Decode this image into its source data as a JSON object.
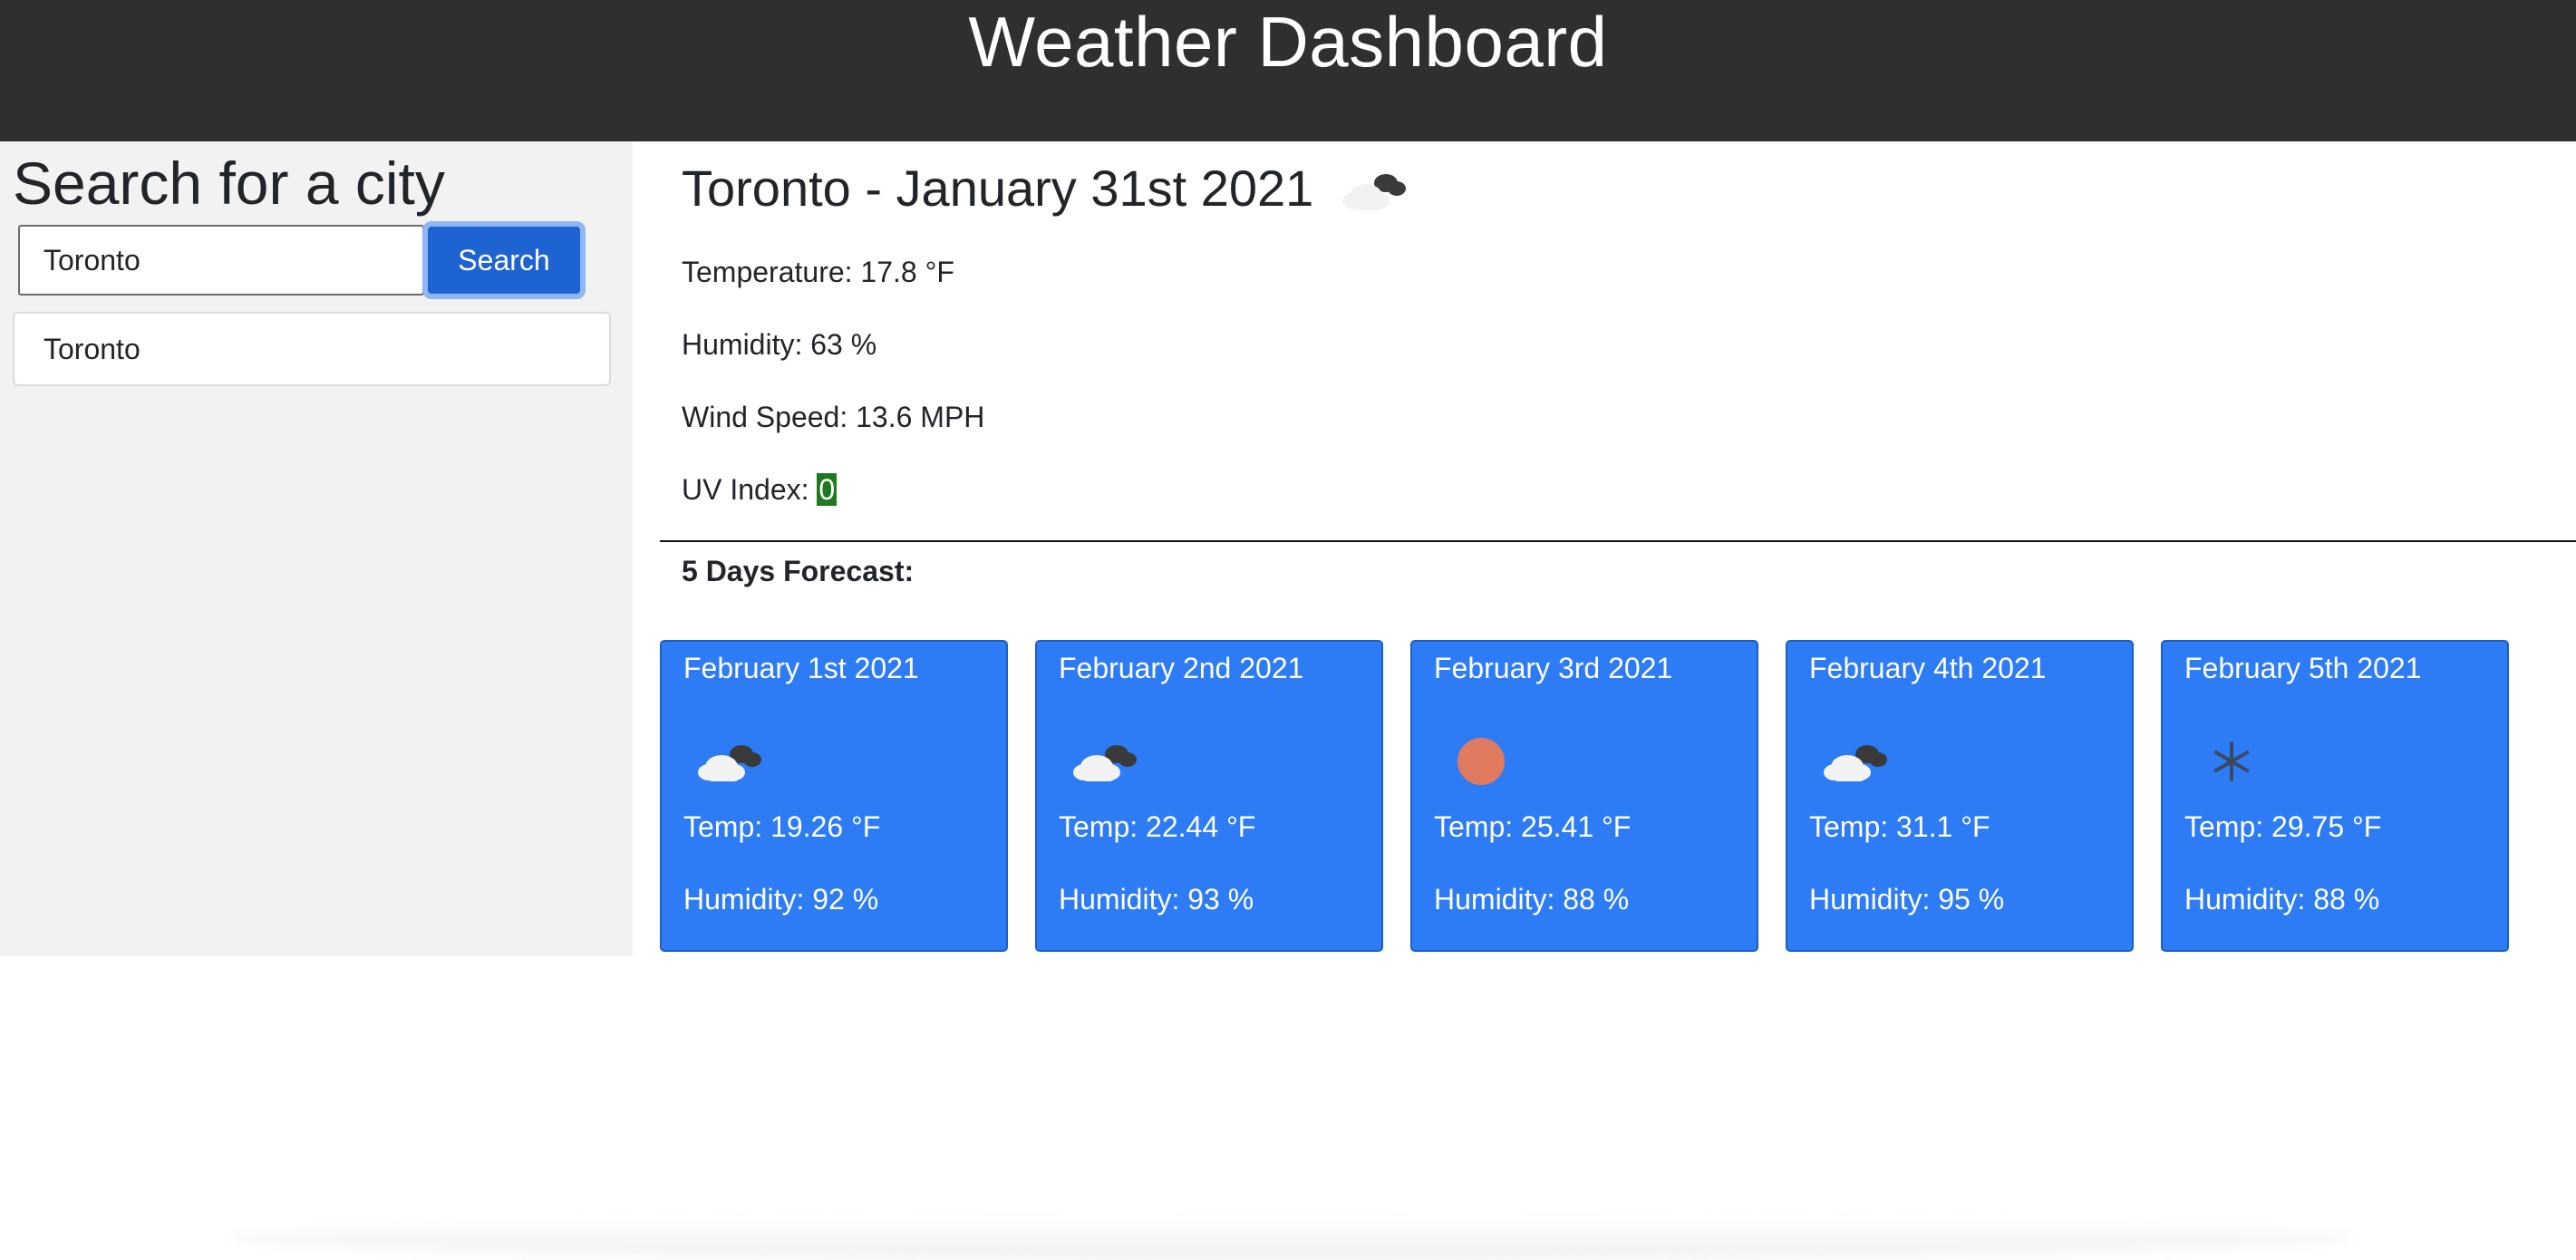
{
  "header": {
    "title": "Weather Dashboard"
  },
  "sidebar": {
    "heading": "Search for a city",
    "search_value": "Toronto",
    "search_button": "Search",
    "history": [
      "Toronto"
    ]
  },
  "current": {
    "heading": "Toronto - January 31st 2021",
    "icon": "cloudy-icon",
    "temperature": "Temperature: 17.8 °F",
    "humidity": "Humidity: 63 %",
    "wind": "Wind Speed: 13.6 MPH",
    "uv_label": "UV Index: ",
    "uv_value": "0",
    "uv_color": "#1f7a1f"
  },
  "forecast": {
    "heading": "5 Days Forecast:",
    "days": [
      {
        "date": "February 1st 2021",
        "icon": "cloudy-icon",
        "temp": "Temp: 19.26 °F",
        "humidity": "Humidity: 92 %"
      },
      {
        "date": "February 2nd 2021",
        "icon": "cloudy-icon",
        "temp": "Temp: 22.44 °F",
        "humidity": "Humidity: 93 %"
      },
      {
        "date": "February 3rd 2021",
        "icon": "sun-icon",
        "temp": "Temp: 25.41 °F",
        "humidity": "Humidity: 88 %"
      },
      {
        "date": "February 4th 2021",
        "icon": "cloudy-icon",
        "temp": "Temp: 31.1 °F",
        "humidity": "Humidity: 95 %"
      },
      {
        "date": "February 5th 2021",
        "icon": "snow-icon",
        "temp": "Temp: 29.75 °F",
        "humidity": "Humidity: 88 %"
      }
    ]
  },
  "colors": {
    "header_bg": "#2f2f2f",
    "sidebar_bg": "#f2f2f2",
    "card_bg": "#2d7cf6",
    "button_bg": "#1e63d2",
    "sun": "#e07a5f"
  }
}
